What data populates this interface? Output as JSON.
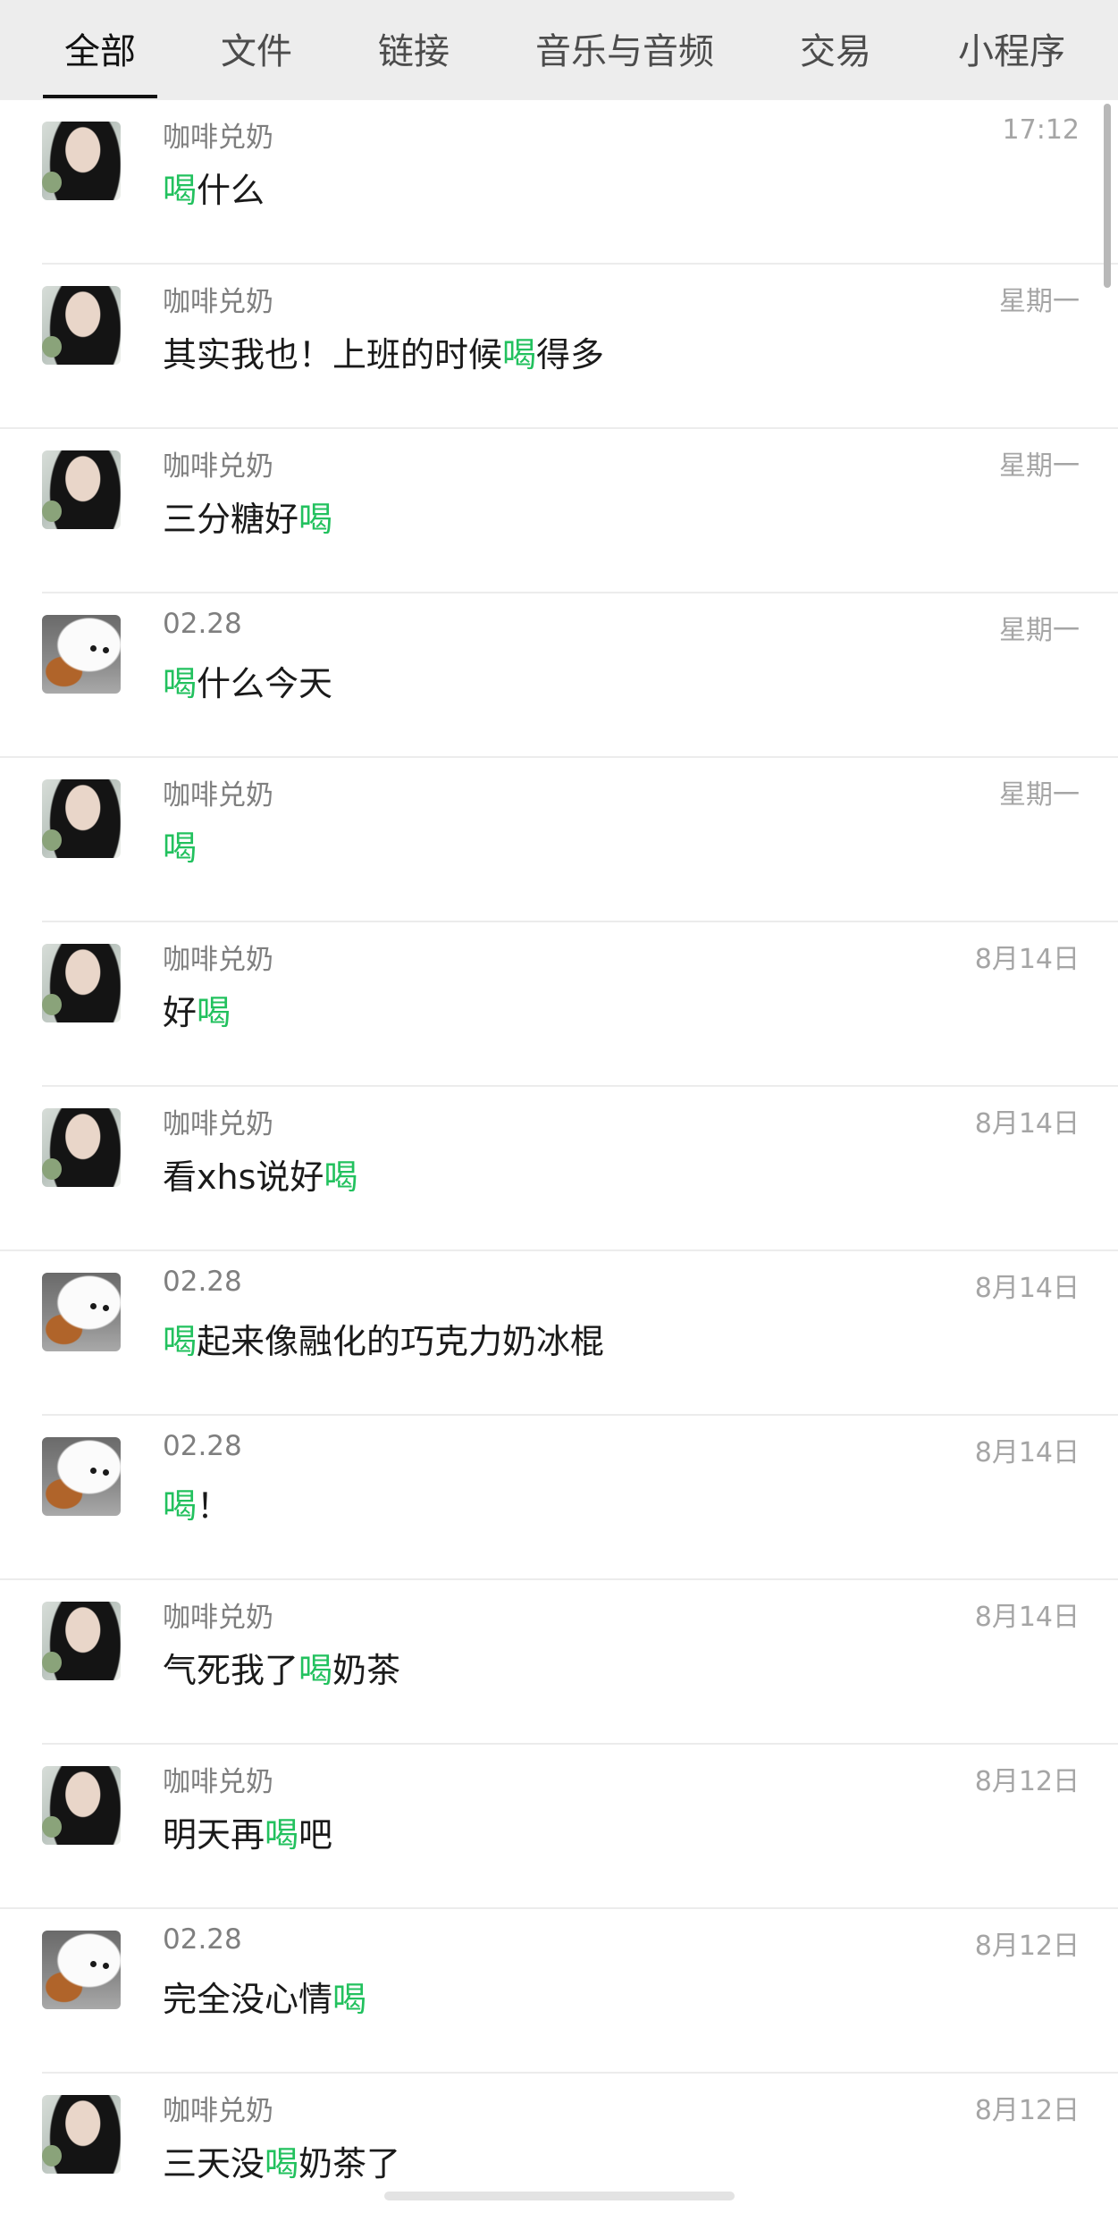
{
  "tabs": [
    {
      "label": "全部",
      "active": true
    },
    {
      "label": "文件"
    },
    {
      "label": "链接"
    },
    {
      "label": "音乐与音频"
    },
    {
      "label": "交易"
    },
    {
      "label": "小程序"
    }
  ],
  "messages": [
    {
      "avatar": "girl-avatar",
      "name": "咖啡兑奶",
      "time": "17:12",
      "pre": "",
      "hl": "喝",
      "post": "什么"
    },
    {
      "avatar": "girl-avatar",
      "name": "咖啡兑奶",
      "time": "星期一",
      "pre": "其实我也！上班的时候",
      "hl": "喝",
      "post": "得多"
    },
    {
      "avatar": "girl-avatar",
      "name": "咖啡兑奶",
      "time": "星期一",
      "pre": "三分糖好",
      "hl": "喝",
      "post": ""
    },
    {
      "avatar": "dog-avatar",
      "name": "02.28",
      "time": "星期一",
      "pre": "",
      "hl": "喝",
      "post": "什么今天"
    },
    {
      "avatar": "girl-avatar",
      "name": "咖啡兑奶",
      "time": "星期一",
      "pre": "",
      "hl": "喝",
      "post": ""
    },
    {
      "avatar": "girl-avatar",
      "name": "咖啡兑奶",
      "time": "8月14日",
      "pre": "好",
      "hl": "喝",
      "post": ""
    },
    {
      "avatar": "girl-avatar",
      "name": "咖啡兑奶",
      "time": "8月14日",
      "pre": "看xhs说好",
      "hl": "喝",
      "post": ""
    },
    {
      "avatar": "dog-avatar",
      "name": "02.28",
      "time": "8月14日",
      "pre": "",
      "hl": "喝",
      "post": "起来像融化的巧克力奶冰棍"
    },
    {
      "avatar": "dog-avatar",
      "name": "02.28",
      "time": "8月14日",
      "pre": "",
      "hl": "喝",
      "post": "！"
    },
    {
      "avatar": "girl-avatar",
      "name": "咖啡兑奶",
      "time": "8月14日",
      "pre": "气死我了",
      "hl": "喝",
      "post": "奶茶"
    },
    {
      "avatar": "girl-avatar",
      "name": "咖啡兑奶",
      "time": "8月12日",
      "pre": "明天再",
      "hl": "喝",
      "post": "吧"
    },
    {
      "avatar": "dog-avatar",
      "name": "02.28",
      "time": "8月12日",
      "pre": "完全没心情",
      "hl": "喝",
      "post": ""
    },
    {
      "avatar": "girl-avatar",
      "name": "咖啡兑奶",
      "time": "8月12日",
      "pre": "三天没",
      "hl": "喝",
      "post": "奶茶了"
    }
  ],
  "colors": {
    "highlight": "#22c15e",
    "tab_bar_bg": "#ededed",
    "name_text": "#7f7f7f",
    "time_text": "#a5a5a5",
    "message_text": "#1a1a1a"
  }
}
